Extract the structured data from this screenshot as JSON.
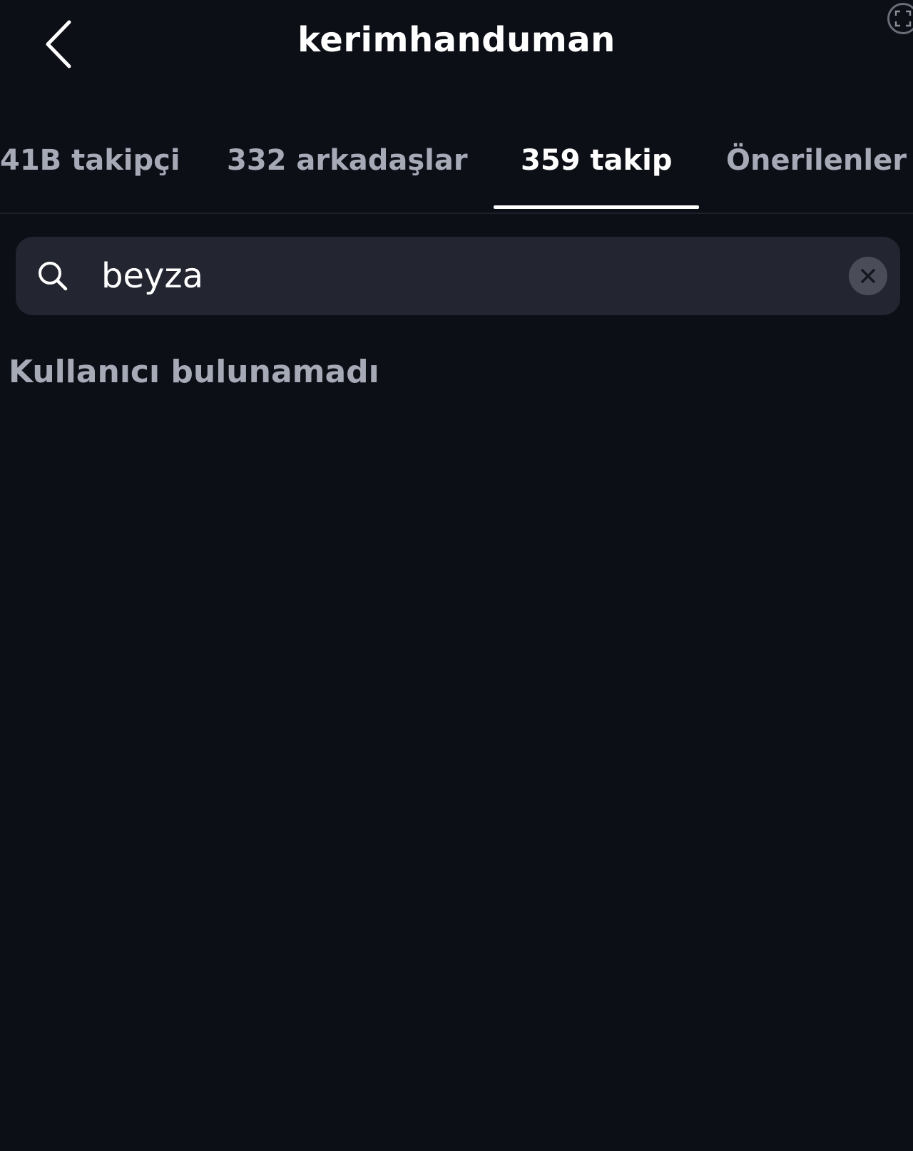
{
  "header": {
    "title": "kerimhanduman",
    "back_icon": "chevron-left-icon",
    "scan_icon": "scan-frame-icon"
  },
  "tabs": [
    {
      "label": "41B takipçi",
      "active": false
    },
    {
      "label": "332 arkadaşlar",
      "active": false
    },
    {
      "label": "359 takip",
      "active": true
    },
    {
      "label": "Önerilenler",
      "active": false
    }
  ],
  "search": {
    "value": "beyza",
    "icon": "search-icon",
    "clear_icon": "close-icon"
  },
  "results": {
    "empty_message": "Kullanıcı bulunamadı"
  },
  "colors": {
    "background": "#0d0f17",
    "search_bg": "#232530",
    "inactive_text": "#a6a9b6",
    "active_text": "#ffffff"
  }
}
